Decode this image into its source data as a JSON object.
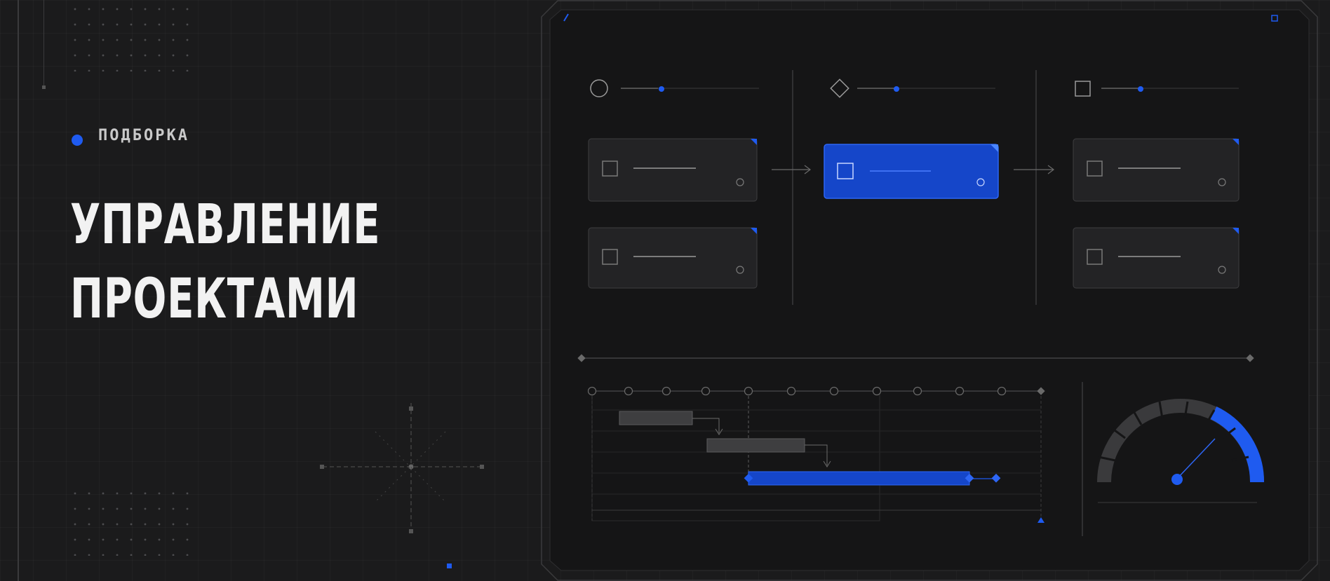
{
  "tag": {
    "label": "ПОДБОРКА"
  },
  "title": {
    "line1": "УПРАВЛЕНИЕ",
    "line2": "ПРОЕКТАМИ"
  },
  "colors": {
    "accent": "#1f5bf0",
    "background": "#1b1b1c",
    "panel": "#151516",
    "text": "#f2f2f2"
  },
  "illustration": {
    "columns": [
      {
        "icon": "circle-icon",
        "cards": 2
      },
      {
        "icon": "diamond-icon",
        "cards": 1,
        "highlighted": true
      },
      {
        "icon": "square-icon",
        "cards": 2
      }
    ],
    "gauge_level": 0.65
  }
}
